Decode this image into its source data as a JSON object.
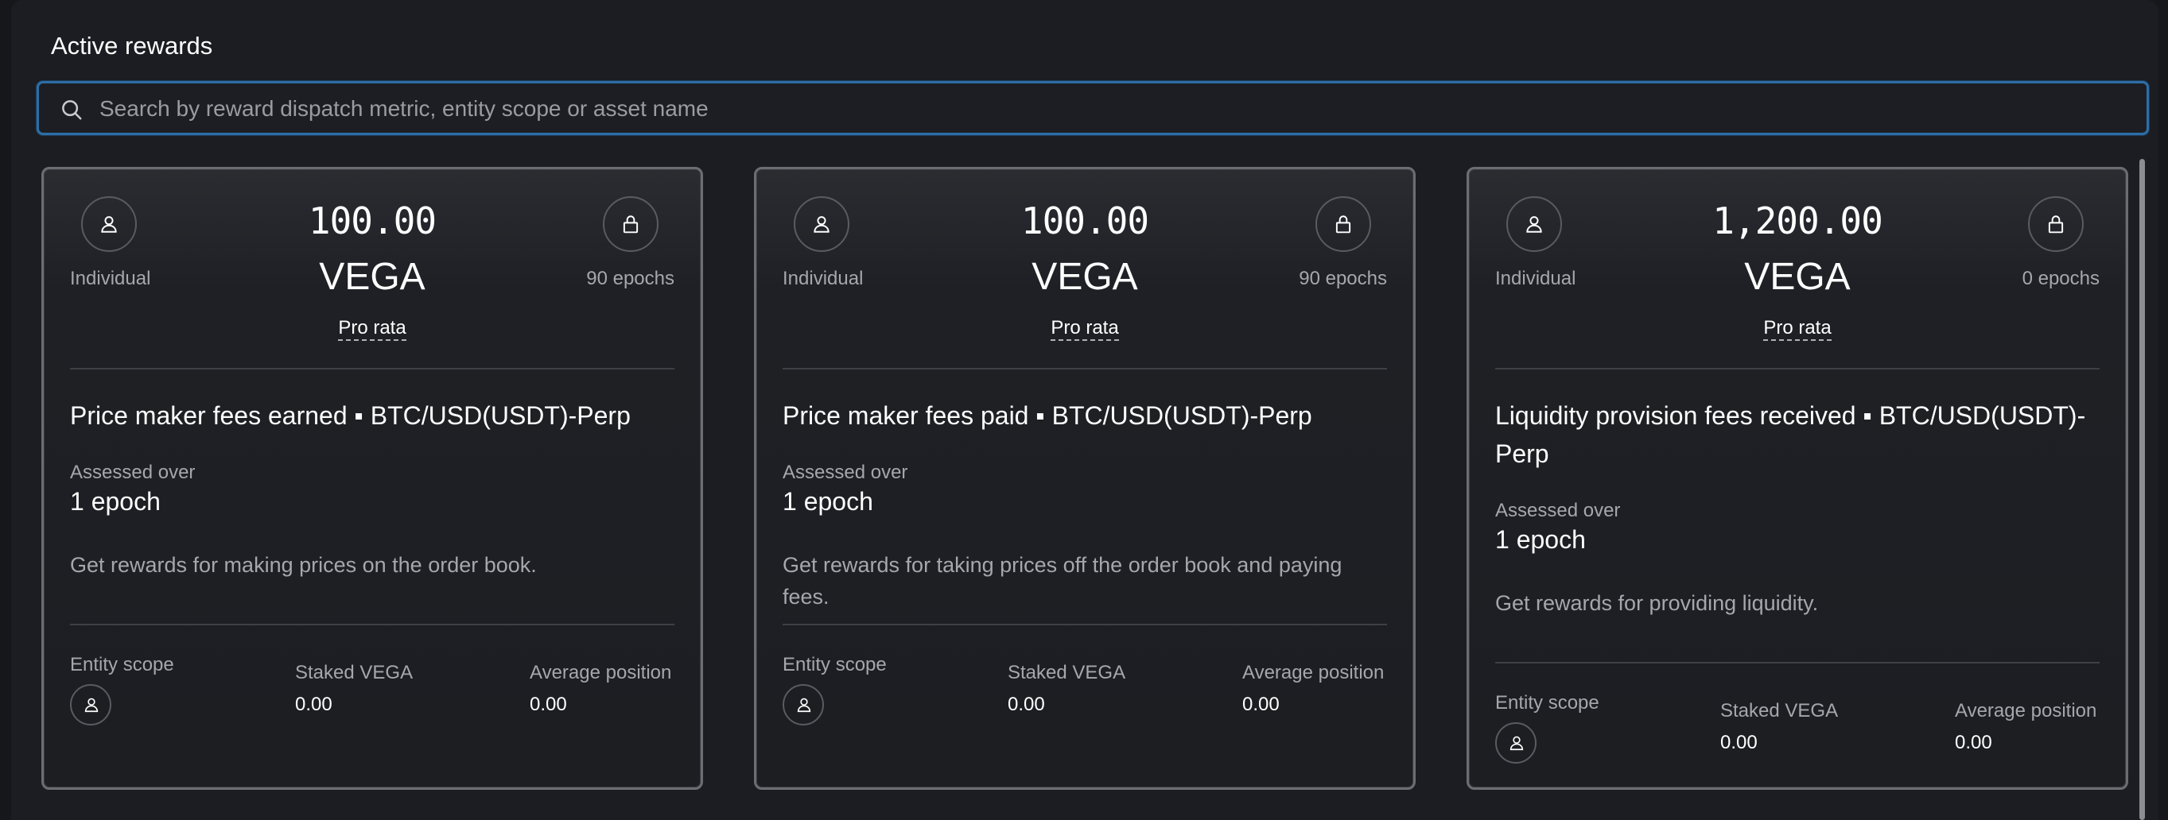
{
  "section": {
    "title": "Active rewards"
  },
  "search": {
    "placeholder": "Search by reward dispatch metric, entity scope or asset name",
    "value": ""
  },
  "cards": [
    {
      "amount": "100.00",
      "asset": "VEGA",
      "scope": "Individual",
      "lock": "90 epochs",
      "distribution": "Pro rata",
      "metric": "Price maker fees earned ▪ BTC/USD(USDT)-Perp",
      "assessed_label": "Assessed over",
      "assessed_value": "1 epoch",
      "description": "Get rewards for making prices on the order book.",
      "entity_scope_label": "Entity scope",
      "staked_label": "Staked VEGA",
      "staked_value": "0.00",
      "avg_label": "Average position",
      "avg_value": "0.00"
    },
    {
      "amount": "100.00",
      "asset": "VEGA",
      "scope": "Individual",
      "lock": "90 epochs",
      "distribution": "Pro rata",
      "metric": "Price maker fees paid ▪ BTC/USD(USDT)-Perp",
      "assessed_label": "Assessed over",
      "assessed_value": "1 epoch",
      "description": "Get rewards for taking prices off the order book and paying fees.",
      "entity_scope_label": "Entity scope",
      "staked_label": "Staked VEGA",
      "staked_value": "0.00",
      "avg_label": "Average position",
      "avg_value": "0.00"
    },
    {
      "amount": "1,200.00",
      "asset": "VEGA",
      "scope": "Individual",
      "lock": "0 epochs",
      "distribution": "Pro rata",
      "metric": "Liquidity provision fees received ▪ BTC/USD(USDT)-Perp",
      "assessed_label": "Assessed over",
      "assessed_value": "1 epoch",
      "description": "Get rewards for providing liquidity.",
      "entity_scope_label": "Entity scope",
      "staked_label": "Staked VEGA",
      "staked_value": "0.00",
      "avg_label": "Average position",
      "avg_value": "0.00"
    }
  ],
  "icons": {
    "search": "search-icon",
    "scope": "user-icon",
    "lock": "lock-icon"
  },
  "colors": {
    "background": "#1b1d22",
    "focus_border": "#2d6ea5",
    "card_border": "#6b6d72",
    "muted_text": "#a5a7ac"
  }
}
